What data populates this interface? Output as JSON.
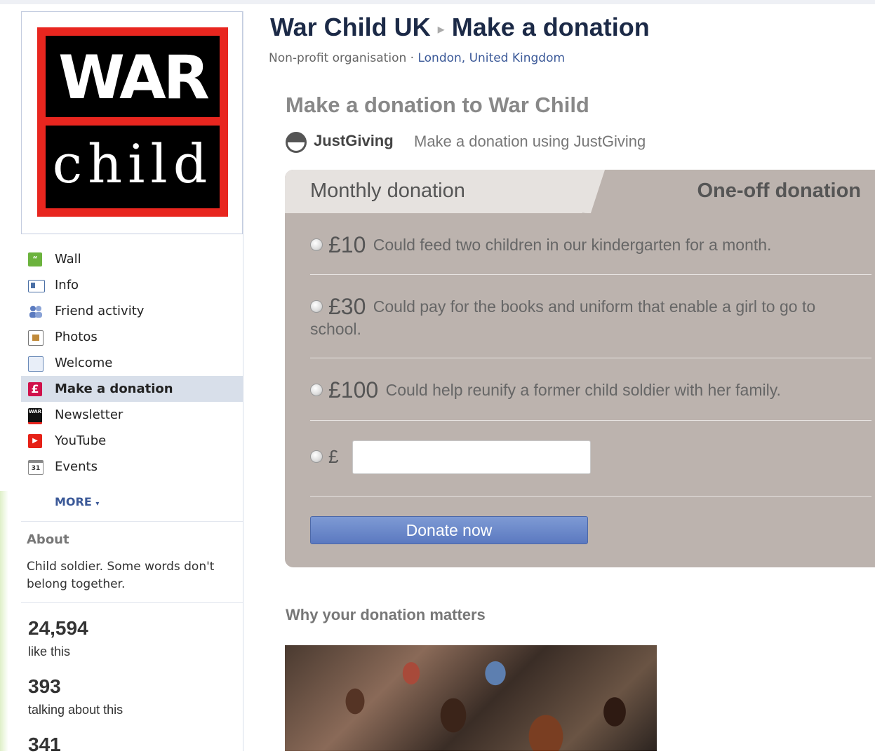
{
  "page": {
    "title": "War Child UK",
    "section": "Make a donation",
    "category": "Non-profit organisation",
    "location": "London, United Kingdom"
  },
  "logo": {
    "line1": "WAR",
    "line2": "child"
  },
  "nav": {
    "items": [
      {
        "label": "Wall",
        "icon": "speech-bubble-icon",
        "color": "#6cb33e"
      },
      {
        "label": "Info",
        "icon": "info-card-icon",
        "color": "#4a6fa5"
      },
      {
        "label": "Friend activity",
        "icon": "friends-icon",
        "color": "#5b7bc0"
      },
      {
        "label": "Photos",
        "icon": "photos-icon",
        "color": "#c08a3a"
      },
      {
        "label": "Welcome",
        "icon": "document-icon",
        "color": "#6a8ab8"
      },
      {
        "label": "Make a donation",
        "icon": "pound-icon",
        "color": "#d0114b",
        "active": true
      },
      {
        "label": "Newsletter",
        "icon": "warchild-logo-icon",
        "color": "#111111"
      },
      {
        "label": "YouTube",
        "icon": "youtube-play-icon",
        "color": "#e62117"
      },
      {
        "label": "Events",
        "icon": "calendar-icon",
        "color": "#888888"
      }
    ],
    "more": "MORE"
  },
  "about": {
    "title": "About",
    "text": "Child soldier. Some words don't belong together."
  },
  "stats": [
    {
      "value": "24,594",
      "label": "like this"
    },
    {
      "value": "393",
      "label": "talking about this"
    },
    {
      "value": "341",
      "label": ""
    }
  ],
  "donation": {
    "heading": "Make a donation to War Child",
    "provider_brand": "JustGiving",
    "provider_text": "Make a donation using JustGiving",
    "tabs": {
      "monthly": "Monthly donation",
      "oneoff": "One-off donation"
    },
    "options": [
      {
        "amount": "£10",
        "description": "Could feed two children in our kindergarten for a month."
      },
      {
        "amount": "£30",
        "description": "Could pay for the books and uniform that enable a girl to go to school."
      },
      {
        "amount": "£100",
        "description": "Could help reunify a former child soldier with her family."
      }
    ],
    "custom_currency": "£",
    "custom_value": "",
    "button": "Donate now"
  },
  "why": {
    "heading": "Why your donation matters"
  },
  "colors": {
    "panel": "#bcb3ae",
    "brand_blue": "#3b5998",
    "logo_red": "#e8261f"
  }
}
